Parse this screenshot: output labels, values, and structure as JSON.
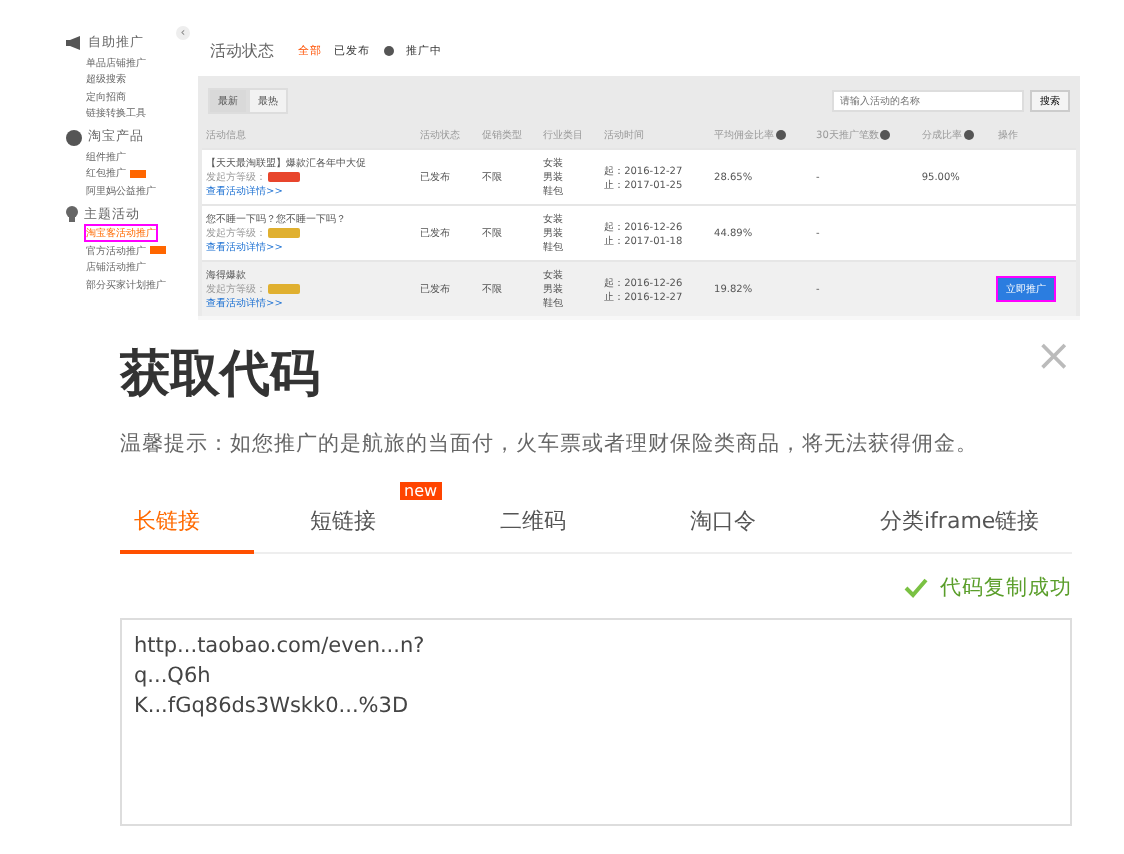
{
  "sidebar": {
    "collapse_icon": "‹",
    "groups": [
      {
        "title": "自助推广",
        "items": [
          {
            "label": "单品店铺推广",
            "selected": false,
            "badge": false
          },
          {
            "label": "超级搜索",
            "selected": false,
            "badge": false
          },
          {
            "label": "定向招商",
            "selected": false,
            "badge": false
          },
          {
            "label": "链接转换工具",
            "selected": false,
            "badge": false
          }
        ]
      },
      {
        "title": "淘宝产品",
        "items": [
          {
            "label": "组件推广",
            "selected": false,
            "badge": false
          },
          {
            "label": "红包推广",
            "selected": false,
            "badge": true
          },
          {
            "label": "阿里妈公益推广",
            "selected": false,
            "badge": false
          }
        ]
      },
      {
        "title": "主题活动",
        "items": [
          {
            "label": "淘宝客活动推广",
            "selected": true,
            "badge": false
          },
          {
            "label": "官方活动推广",
            "selected": false,
            "badge": true
          },
          {
            "label": "店铺活动推广",
            "selected": false,
            "badge": false
          },
          {
            "label": "部分买家计划推广",
            "selected": false,
            "badge": false
          }
        ]
      }
    ]
  },
  "status_filter": {
    "label": "活动状态",
    "options": [
      {
        "label": "全部",
        "selected": true,
        "help": false
      },
      {
        "label": "已发布",
        "selected": false,
        "help": true
      },
      {
        "label": "推广中",
        "selected": false,
        "help": false
      }
    ]
  },
  "sort_tabs": [
    {
      "label": "最新",
      "selected": true
    },
    {
      "label": "最热",
      "selected": false
    }
  ],
  "search": {
    "placeholder": "请输入活动的名称",
    "button": "搜索"
  },
  "table": {
    "columns": [
      {
        "label": "活动信息",
        "help": false
      },
      {
        "label": "活动状态",
        "help": false
      },
      {
        "label": "促销类型",
        "help": false
      },
      {
        "label": "行业类目",
        "help": false
      },
      {
        "label": "活动时间",
        "help": false
      },
      {
        "label": "平均佣金比率",
        "help": true
      },
      {
        "label": "30天推广笔数",
        "help": true
      },
      {
        "label": "分成比率",
        "help": true
      },
      {
        "label": "操作",
        "help": false
      }
    ],
    "rows": [
      {
        "name": "【天天最淘联盟】爆款汇各年中大促",
        "level_label": "发起方等级：",
        "color": "#e8452c",
        "details": "查看活动详情>>",
        "status": "已发布",
        "promo": "不限",
        "categories": [
          "女装",
          "男装",
          "鞋包"
        ],
        "start": "起：2016-12-27",
        "end": "止：2017-01-25",
        "commission": "28.65%",
        "sales": "-",
        "share": "95.00%",
        "selected": false
      },
      {
        "name": "您不睡一下吗？您不睡一下吗？",
        "level_label": "发起方等级：",
        "color": "#e0b030",
        "details": "查看活动详情>>",
        "status": "已发布",
        "promo": "不限",
        "categories": [
          "女装",
          "男装",
          "鞋包"
        ],
        "start": "起：2016-12-26",
        "end": "止：2017-01-18",
        "commission": "44.89%",
        "sales": "-",
        "selected": false
      },
      {
        "name": "海得爆款",
        "level_label": "发起方等级：",
        "color": "#e0b030",
        "details": "查看活动详情>>",
        "status": "已发布",
        "promo": "不限",
        "categories": [
          "女装",
          "男装",
          "鞋包"
        ],
        "start": "起：2016-12-26",
        "end": "止：2016-12-27",
        "commission": "19.82%",
        "sales": "-",
        "action": "立即推广",
        "selected": true
      }
    ]
  },
  "dialog": {
    "title": "获取代码",
    "close": "×",
    "hint": "温馨提示：如您推广的是航旅的当面付，火车票或者理财保险类商品，将无法获得佣金。",
    "tabs": [
      {
        "label": "长链接",
        "selected": true
      },
      {
        "label": "短链接",
        "selected": false,
        "badge": "new"
      },
      {
        "label": "二维码",
        "selected": false
      },
      {
        "label": "淘口令",
        "selected": false
      },
      {
        "label": "分类iframe链接",
        "selected": false
      }
    ],
    "success": "代码复制成功",
    "code": [
      "http...taobao.com/even...n?",
      "q...Q6h",
      "K...fGq86ds3Wskk0...%3D"
    ]
  }
}
